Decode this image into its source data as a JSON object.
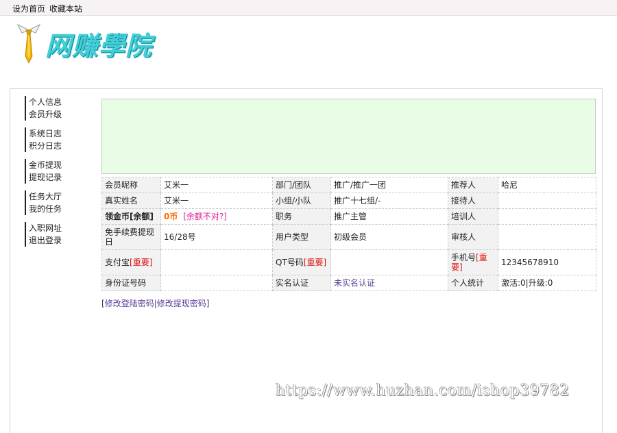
{
  "topbar": {
    "set_home": "设为首页",
    "bookmark": "收藏本站"
  },
  "logo": {
    "text": "网赚學院",
    "icon": "tie-icon"
  },
  "sidebar": {
    "items": [
      "个人信息",
      "会员升级",
      "系统日志",
      "积分日志",
      "金币提现",
      "提现记录",
      "任务大厅",
      "我的任务",
      "入职网址",
      "退出登录"
    ]
  },
  "table": {
    "r1": {
      "l1": "会员昵称",
      "v1": "艾米一",
      "l2": "部门/团队",
      "v2": "推广/推广一团",
      "l3": "推荐人",
      "v3": "哈尼"
    },
    "r2": {
      "l1": "真实姓名",
      "v1": "艾米一",
      "l2": "小组/小队",
      "v2": "推广十七组/-",
      "l3": "接待人",
      "v3": ""
    },
    "r3": {
      "l1": "领金币[余额]",
      "v1a": "0币",
      "v1b": "[余额不对?]",
      "l2": "职务",
      "v2": "推广主管",
      "l3": "培训人",
      "v3": ""
    },
    "r4": {
      "l1": "免手续费提现日",
      "v1": "16/28号",
      "l2": "用户类型",
      "v2": "初级会员",
      "l3": "审核人",
      "v3": ""
    },
    "r5": {
      "l1": "支付宝",
      "l1_tag": "[重要]",
      "v1": "",
      "l2": "QT号码",
      "l2_tag": "[重要]",
      "v2": "",
      "l3": "手机号",
      "l3_tag": "[重要]",
      "v3": "12345678910"
    },
    "r6": {
      "l1": "身份证号码",
      "v1": "",
      "l2": "实名认证",
      "v2": "未实名认证",
      "l3": "个人统计",
      "v3": "激活:0|升级:0"
    }
  },
  "links": {
    "open": "[",
    "change_login_pw": "修改登陆密码",
    "sep": "|",
    "change_withdraw_pw": "修改提现密码",
    "close": "]"
  },
  "watermark": "https://www.huzhan.com/ishop39782",
  "colors": {
    "notice_bg": "#e8fce6",
    "important": "#dd1111",
    "coin": "#ff6a00",
    "link": "#5b3e9a"
  }
}
